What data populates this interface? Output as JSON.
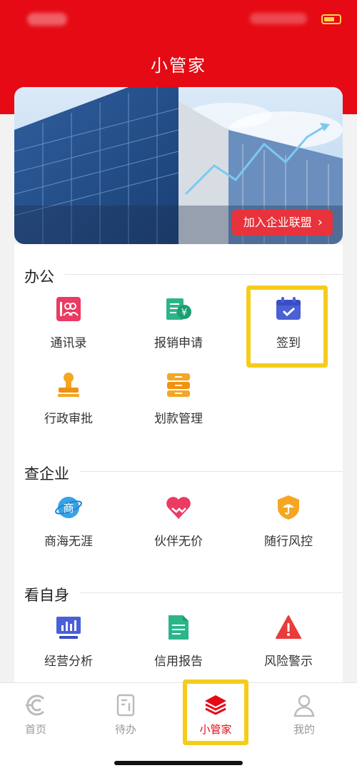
{
  "header": {
    "title": "小管家"
  },
  "banner": {
    "join_label": "加入企业联盟"
  },
  "sections": [
    {
      "title": "办公",
      "items": [
        {
          "label": "通讯录",
          "icon": "contacts-icon"
        },
        {
          "label": "报销申请",
          "icon": "reimbursement-icon"
        },
        {
          "label": "签到",
          "icon": "calendar-check-icon"
        },
        {
          "label": "行政审批",
          "icon": "stamp-icon"
        },
        {
          "label": "划款管理",
          "icon": "drawer-icon"
        }
      ]
    },
    {
      "title": "查企业",
      "items": [
        {
          "label": "商海无涯",
          "icon": "commerce-globe-icon"
        },
        {
          "label": "伙伴无价",
          "icon": "handshake-heart-icon"
        },
        {
          "label": "随行风控",
          "icon": "shield-umbrella-icon"
        }
      ]
    },
    {
      "title": "看自身",
      "items": [
        {
          "label": "经营分析",
          "icon": "bar-chart-monitor-icon"
        },
        {
          "label": "信用报告",
          "icon": "report-document-icon"
        },
        {
          "label": "风险警示",
          "icon": "warning-triangle-icon"
        }
      ]
    }
  ],
  "tabbar": [
    {
      "label": "首页",
      "icon": "home-logo-icon",
      "active": false
    },
    {
      "label": "待办",
      "icon": "todo-icon",
      "active": false
    },
    {
      "label": "小管家",
      "icon": "layers-icon",
      "active": true
    },
    {
      "label": "我的",
      "icon": "profile-icon",
      "active": false
    }
  ],
  "colors": {
    "brand_red": "#e60a14",
    "highlight_yellow": "#f5cc1a"
  },
  "commerce_glyph": "商"
}
